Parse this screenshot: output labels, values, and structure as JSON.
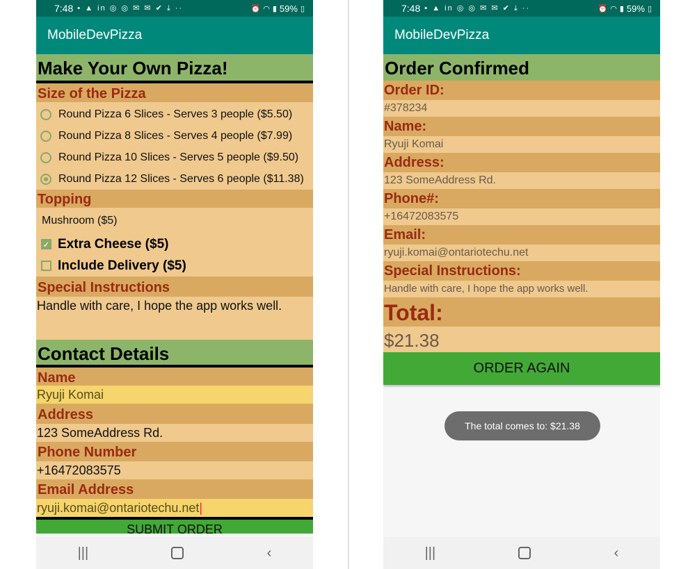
{
  "status": {
    "time": "7:48",
    "notifications": "▪ ▲ in ◎ ◎ ✉ ✉ ✔ ⤓ ··",
    "battery": "59%"
  },
  "app": {
    "title": "MobileDevPizza"
  },
  "left": {
    "heading": "Make Your Own Pizza!",
    "size_header": "Size of the Pizza",
    "sizes": [
      {
        "label": "Round Pizza 6 Slices - Serves 3 people ($5.50)",
        "selected": false
      },
      {
        "label": "Round Pizza 8 Slices - Serves 4 people ($7.99)",
        "selected": false
      },
      {
        "label": "Round Pizza 10 Slices - Serves 5 people ($9.50)",
        "selected": false
      },
      {
        "label": "Round Pizza 12 Slices - Serves 6 people ($11.38)",
        "selected": true
      }
    ],
    "topping_header": "Topping",
    "topping_value": "Mushroom ($5)",
    "extra_cheese": {
      "label": "Extra Cheese ($5)",
      "checked": true
    },
    "delivery": {
      "label": "Include Delivery ($5)",
      "checked": false
    },
    "instructions_header": "Special Instructions",
    "instructions_value": "Handle with care, I hope the app works well.",
    "contact_heading": "Contact Details",
    "name_label": "Name",
    "name_value": "Ryuji Komai",
    "address_label": "Address",
    "address_value": "123 SomeAddress Rd.",
    "phone_label": "Phone Number",
    "phone_value": "+16472083575",
    "email_label": "Email Address",
    "email_value": "ryuji.komai@ontariotechu.net",
    "submit_label": "SUBMIT ORDER"
  },
  "right": {
    "heading": "Order Confirmed",
    "order_id_label": "Order ID:",
    "order_id_value": "#378234",
    "name_label": "Name:",
    "name_value": "Ryuji Komai",
    "address_label": "Address:",
    "address_value": "123 SomeAddress Rd.",
    "phone_label": "Phone#:",
    "phone_value": "+16472083575",
    "email_label": "Email:",
    "email_value": "ryuji.komai@ontariotechu.net",
    "instructions_label": "Special Instructions:",
    "instructions_value": "Handle with care, I hope the app works well.",
    "total_label": "Total:",
    "total_value": "$21.38",
    "again_label": "ORDER AGAIN",
    "toast": "The total comes to: $21.38"
  },
  "colors": {
    "appbar": "#00897b",
    "statusbar": "#00695c",
    "heading_green": "#8db56a",
    "orange_header": "#d9a961",
    "tan": "#efc98e",
    "yellow_field": "#f5d56c",
    "button_green": "#43a936",
    "label_red": "#9a2a10"
  },
  "icons": [
    "message-icon",
    "chat-icon",
    "linkedin-icon",
    "wifi-icon",
    "signal-icon",
    "battery-icon",
    "recent-apps-icon",
    "home-icon",
    "back-icon"
  ]
}
